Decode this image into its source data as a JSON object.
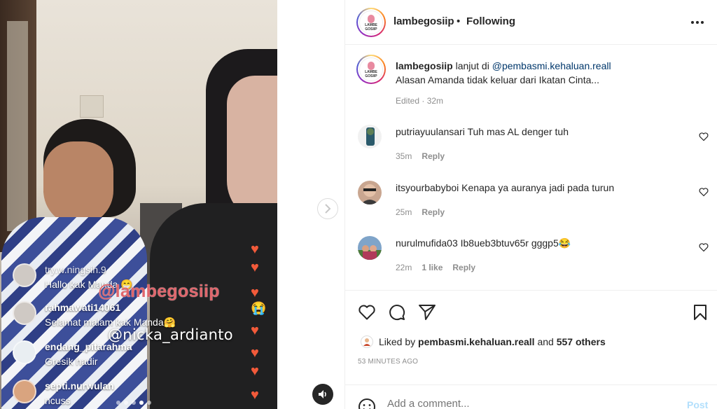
{
  "video": {
    "overlay_comments": [
      {
        "user": "try.w.ningsih.9",
        "message": "Hallo kak Manda 😁"
      },
      {
        "user": "rahmawati14061",
        "message": "Selamat malam kak Manda🤗"
      },
      {
        "user": "endang_pitarahma",
        "message": "Gresik hadir"
      },
      {
        "user": "septi.nurwulan",
        "message": "ncuss"
      }
    ],
    "watermark_primary": "@lambegosiip",
    "watermark_secondary": "@nicka_ardianto",
    "reaction_icon": "heart-icon",
    "carousel": {
      "count": 5,
      "active_index": 3
    }
  },
  "nav": {
    "next_icon": "chevron-right-icon",
    "mute_icon": "speaker-icon"
  },
  "header": {
    "username": "lambegosiip",
    "separator": "•",
    "follow_status": "Following",
    "more_icon": "more-horizontal-icon",
    "logo_text": "LAMBE GOSIIP"
  },
  "caption": {
    "username": "lambegosiip",
    "text_before": " lanjut di ",
    "mention": "@pembasmi.kehaluan.reall",
    "line2": "Alasan Amanda tidak keluar dari Ikatan Cinta...",
    "edited": "Edited · 32m"
  },
  "comments": [
    {
      "username": "putriayuulansari",
      "text": " Tuh mas AL denger tuh",
      "time": "35m",
      "likes": "",
      "reply": "Reply"
    },
    {
      "username": "itsyourbabyboi",
      "text": " Kenapa ya auranya jadi pada turun",
      "time": "25m",
      "likes": "",
      "reply": "Reply"
    },
    {
      "username": "nurulmufida03",
      "text": " Ib8ueb3btuv65r gggp5😂",
      "time": "22m",
      "likes": "1 like",
      "reply": "Reply"
    }
  ],
  "actions": {
    "like_icon": "heart-icon",
    "comment_icon": "comment-icon",
    "share_icon": "send-icon",
    "save_icon": "bookmark-icon"
  },
  "likes": {
    "prefix": "Liked by ",
    "user": "pembasmi.kehaluan.reall",
    "middle": " and ",
    "others": "557 others"
  },
  "timestamp": "53 MINUTES AGO",
  "add_comment": {
    "placeholder": "Add a comment...",
    "post_label": "Post",
    "emoji_icon": "emoji-icon"
  },
  "colors": {
    "link": "#00376b",
    "muted": "#8e8e8e",
    "post_disabled": "#b2dffc",
    "heart_reaction": "#f25a3a",
    "watermark": "#e0666c"
  }
}
